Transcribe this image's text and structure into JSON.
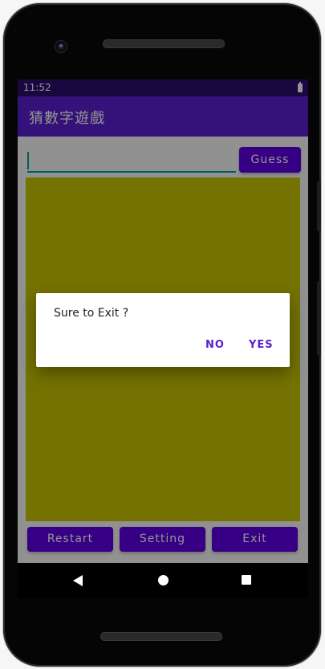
{
  "status_bar": {
    "time": "11:52",
    "battery_icon": "battery-icon"
  },
  "app_bar": {
    "title": "猜數字遊戲"
  },
  "input": {
    "value": "",
    "placeholder": ""
  },
  "buttons": {
    "guess": "Guess",
    "restart": "Restart",
    "setting": "Setting",
    "exit": "Exit"
  },
  "dialog": {
    "message": "Sure to Exit ?",
    "no_label": "NO",
    "yes_label": "YES"
  },
  "nav_bar": {
    "back_icon": "back-triangle-icon",
    "home_icon": "home-circle-icon",
    "recents_icon": "recents-square-icon"
  },
  "colors": {
    "status_bar": "#2c0d6e",
    "app_bar": "#5a1fd0",
    "button": "#5f00e3",
    "game_area": "#c8c400",
    "input_accent": "#03a296",
    "dialog_button_text": "#5a1fd0"
  }
}
